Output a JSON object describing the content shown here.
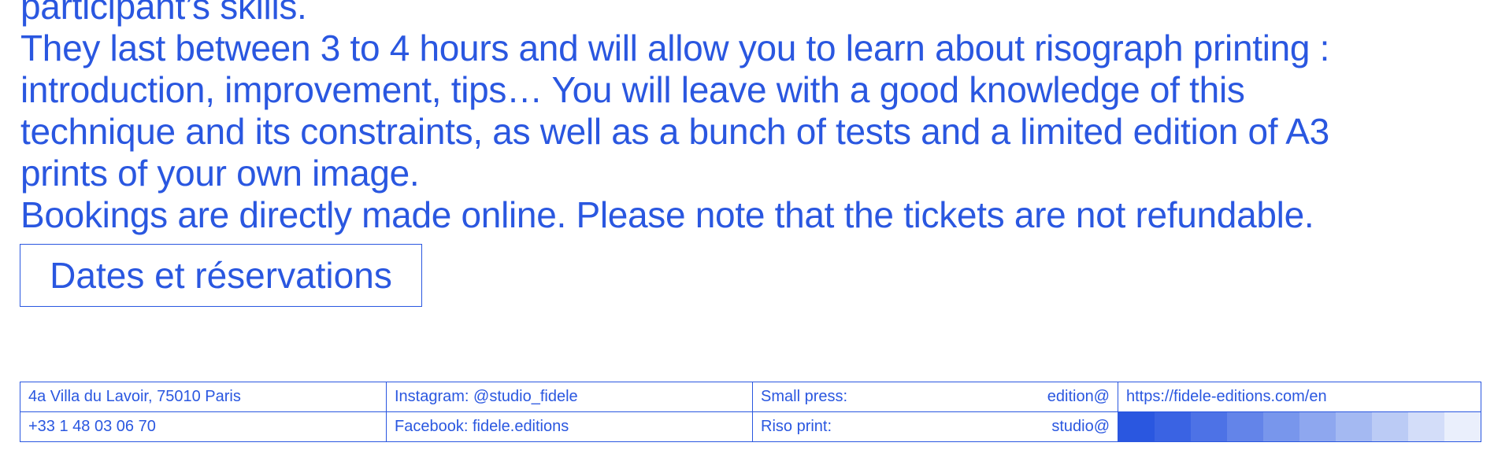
{
  "paragraphs": [
    "participant’s skills.",
    "They last between 3 to 4 hours and will allow you to learn about risograph printing :\nintroduction, improvement, tips… You will leave with a good knowledge of this\ntechnique and its constraints, as well as a bunch of tests and a limited edition of A3\nprints of your own image.",
    "Bookings are directly made online. Please note that the tickets are not refundable."
  ],
  "cta": {
    "label": "Dates et réservations"
  },
  "footer": {
    "address": "4a Villa du Lavoir, 75010 Paris",
    "phone": "+33 1 48 03 06 70",
    "instagram": "Instagram: @studio_fidele",
    "facebook": "Facebook: fidele.editions",
    "small_press_label": "Small press:",
    "small_press_email": "edition@",
    "riso_print_label": "Riso print:",
    "riso_print_email": "studio@",
    "url": "https://fidele-editions.com/en",
    "swatch_colors": [
      "#2a57e0",
      "#3a63e3",
      "#4d72e6",
      "#6384e9",
      "#7896ec",
      "#8ea7ef",
      "#a4b9f2",
      "#bbcbf5",
      "#d3ddf9",
      "#eaeffc"
    ]
  }
}
